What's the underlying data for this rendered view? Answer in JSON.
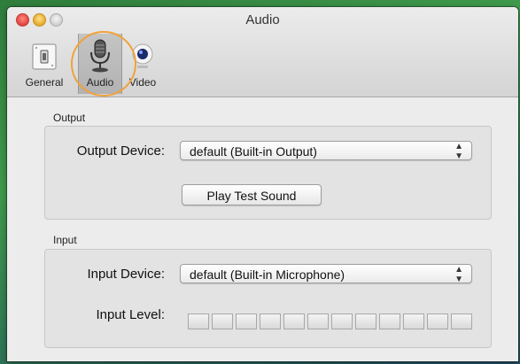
{
  "window": {
    "title": "Audio"
  },
  "toolbar": {
    "items": [
      {
        "label": "General",
        "icon": "switch-icon"
      },
      {
        "label": "Audio",
        "icon": "microphone-icon",
        "selected": true
      },
      {
        "label": "Video",
        "icon": "webcam-icon"
      }
    ]
  },
  "output": {
    "group_label": "Output",
    "device_label": "Output Device:",
    "device_value": "default (Built-in Output)",
    "test_button": "Play Test Sound"
  },
  "input": {
    "group_label": "Input",
    "device_label": "Input Device:",
    "device_value": "default (Built-in Microphone)",
    "level_label": "Input Level:",
    "level_segments": 12,
    "level_value": 0
  },
  "colors": {
    "highlight_ring": "#f0a23a",
    "window_bg": "#ececec"
  }
}
